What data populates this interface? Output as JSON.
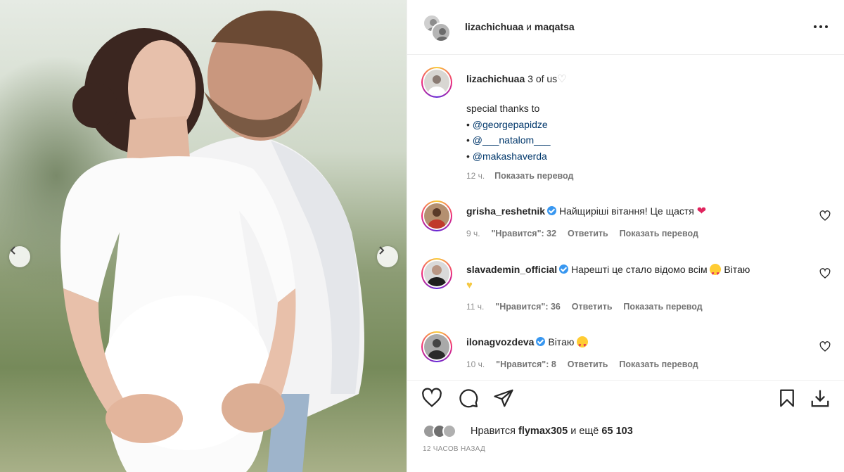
{
  "header": {
    "title_user1": "lizachichuaa",
    "title_sep": "и",
    "title_user2": "maqatsa",
    "more_icon": "more-horizontal-icon"
  },
  "caption": {
    "username": "lizachichuaa",
    "text": "3 of us",
    "line1": "special thanks to",
    "bullet": "•",
    "mentions": [
      "@georgepapidze",
      "@___natalom___",
      "@makashaverda"
    ],
    "time": "12 ч.",
    "translate": "Показать перевод"
  },
  "comments": [
    {
      "username": "grisha_reshetnik",
      "verified": true,
      "text": "Найщиріші вітання! Це щастя",
      "emoji": "red-heart",
      "time": "9 ч.",
      "likes": "\"Нравится\": 32",
      "reply": "Ответить",
      "translate": "Показать перевод"
    },
    {
      "username": "slavademin_official",
      "verified": true,
      "text": "Нарешті це стало відомо всім",
      "text2": "Вітаю",
      "emoji": "heart-eyes",
      "time": "11 ч.",
      "likes": "\"Нравится\": 36",
      "reply": "Ответить",
      "translate": "Показать перевод"
    },
    {
      "username": "ilonagvozdeva",
      "verified": true,
      "text": "Вітаю",
      "emoji": "heart-eyes",
      "time": "10 ч.",
      "likes": "\"Нравится\": 8",
      "reply": "Ответить",
      "translate": "Показать перевод"
    }
  ],
  "likes_line": {
    "prefix": "Нравится",
    "user": "flymax305",
    "middle": "и ещё",
    "count": "65 103"
  },
  "timestamp": "12 ЧАСОВ НАЗАД",
  "colors": {
    "link": "#00376b",
    "verified": "#3897f0",
    "heart": "#ed4956"
  }
}
